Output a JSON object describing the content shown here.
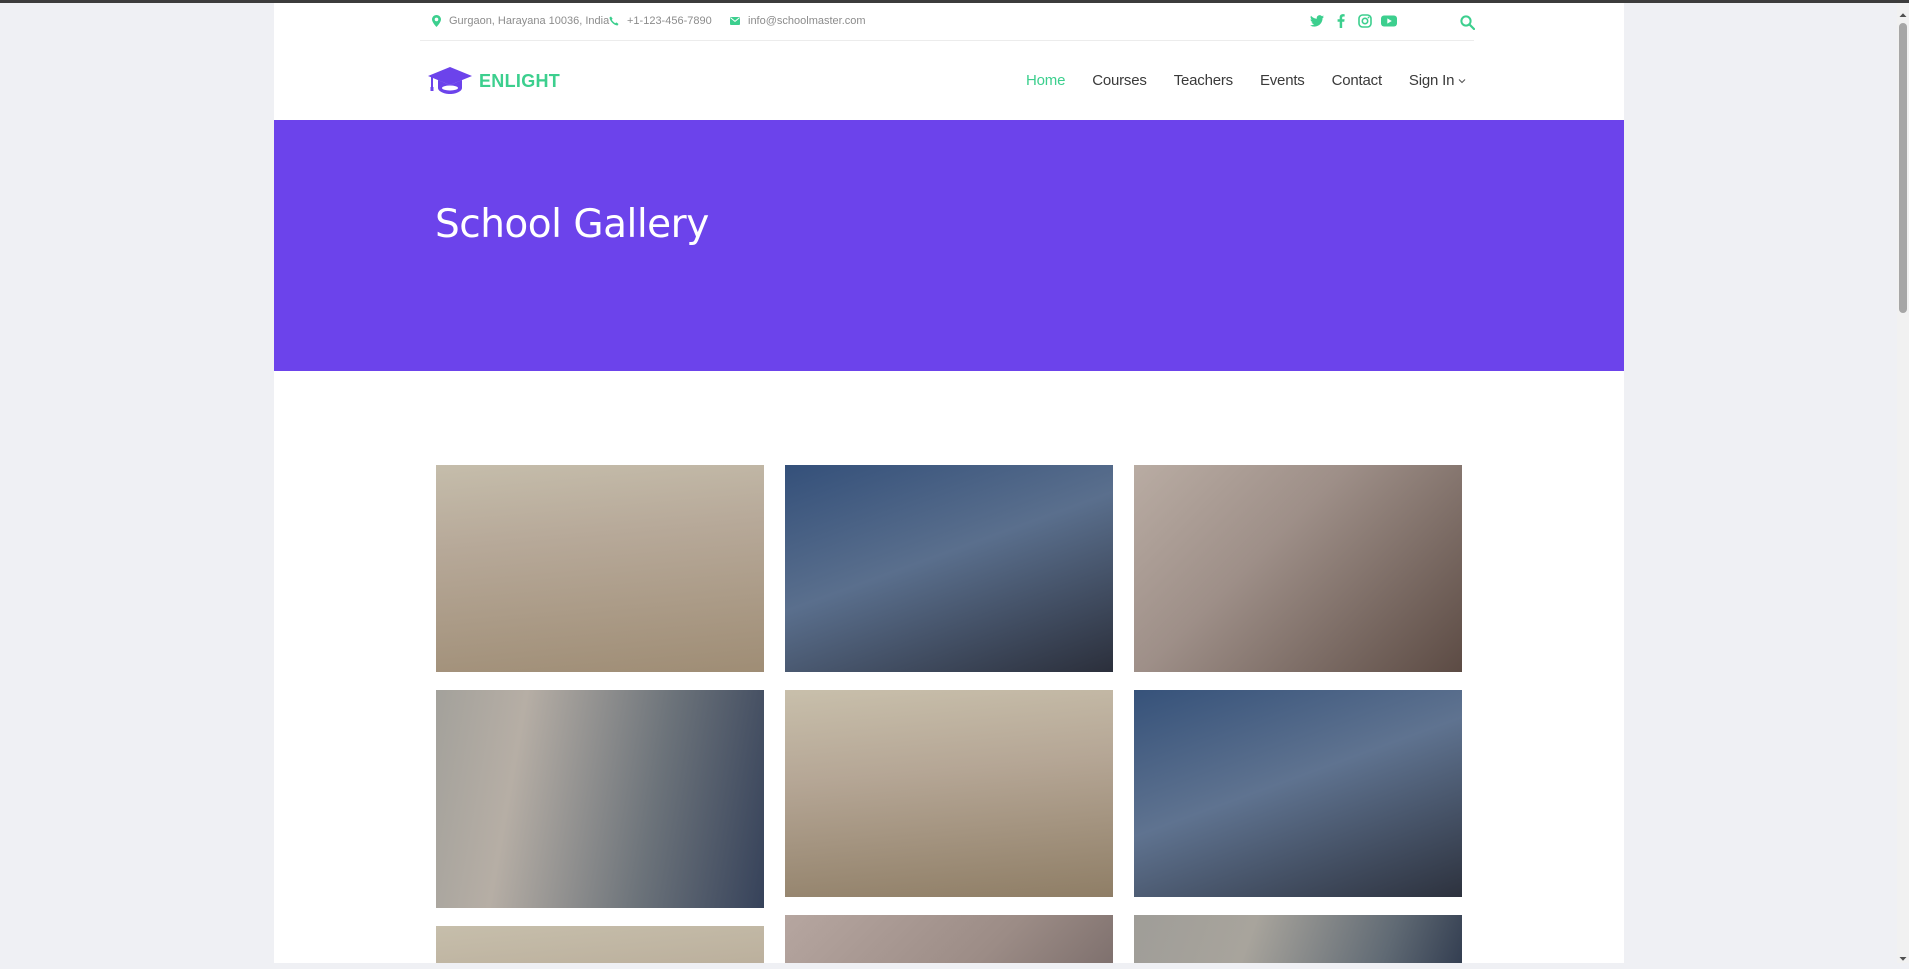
{
  "topbar": {
    "address": "Gurgaon, Harayana 10036, India",
    "phone": "+1-123-456-7890",
    "email": "info@schoolmaster.com",
    "social_icons": [
      "twitter-icon",
      "facebook-icon",
      "instagram-icon",
      "youtube-icon"
    ],
    "search_icon": "search-icon"
  },
  "brand": {
    "name": "ENLIGHT",
    "logo_icon": "graduation-cap-icon",
    "logo_color": "#6c43eb",
    "text_color": "#3ccf8e"
  },
  "nav": {
    "items": [
      "Home",
      "Courses",
      "Teachers",
      "Events",
      "Contact",
      "Sign In"
    ],
    "active": "Home"
  },
  "hero": {
    "title": "School Gallery",
    "background": "#6c43eb"
  },
  "colors": {
    "accent": "#3ccf8e",
    "primary": "#6c43eb",
    "nav_text": "#3a3a3a"
  }
}
